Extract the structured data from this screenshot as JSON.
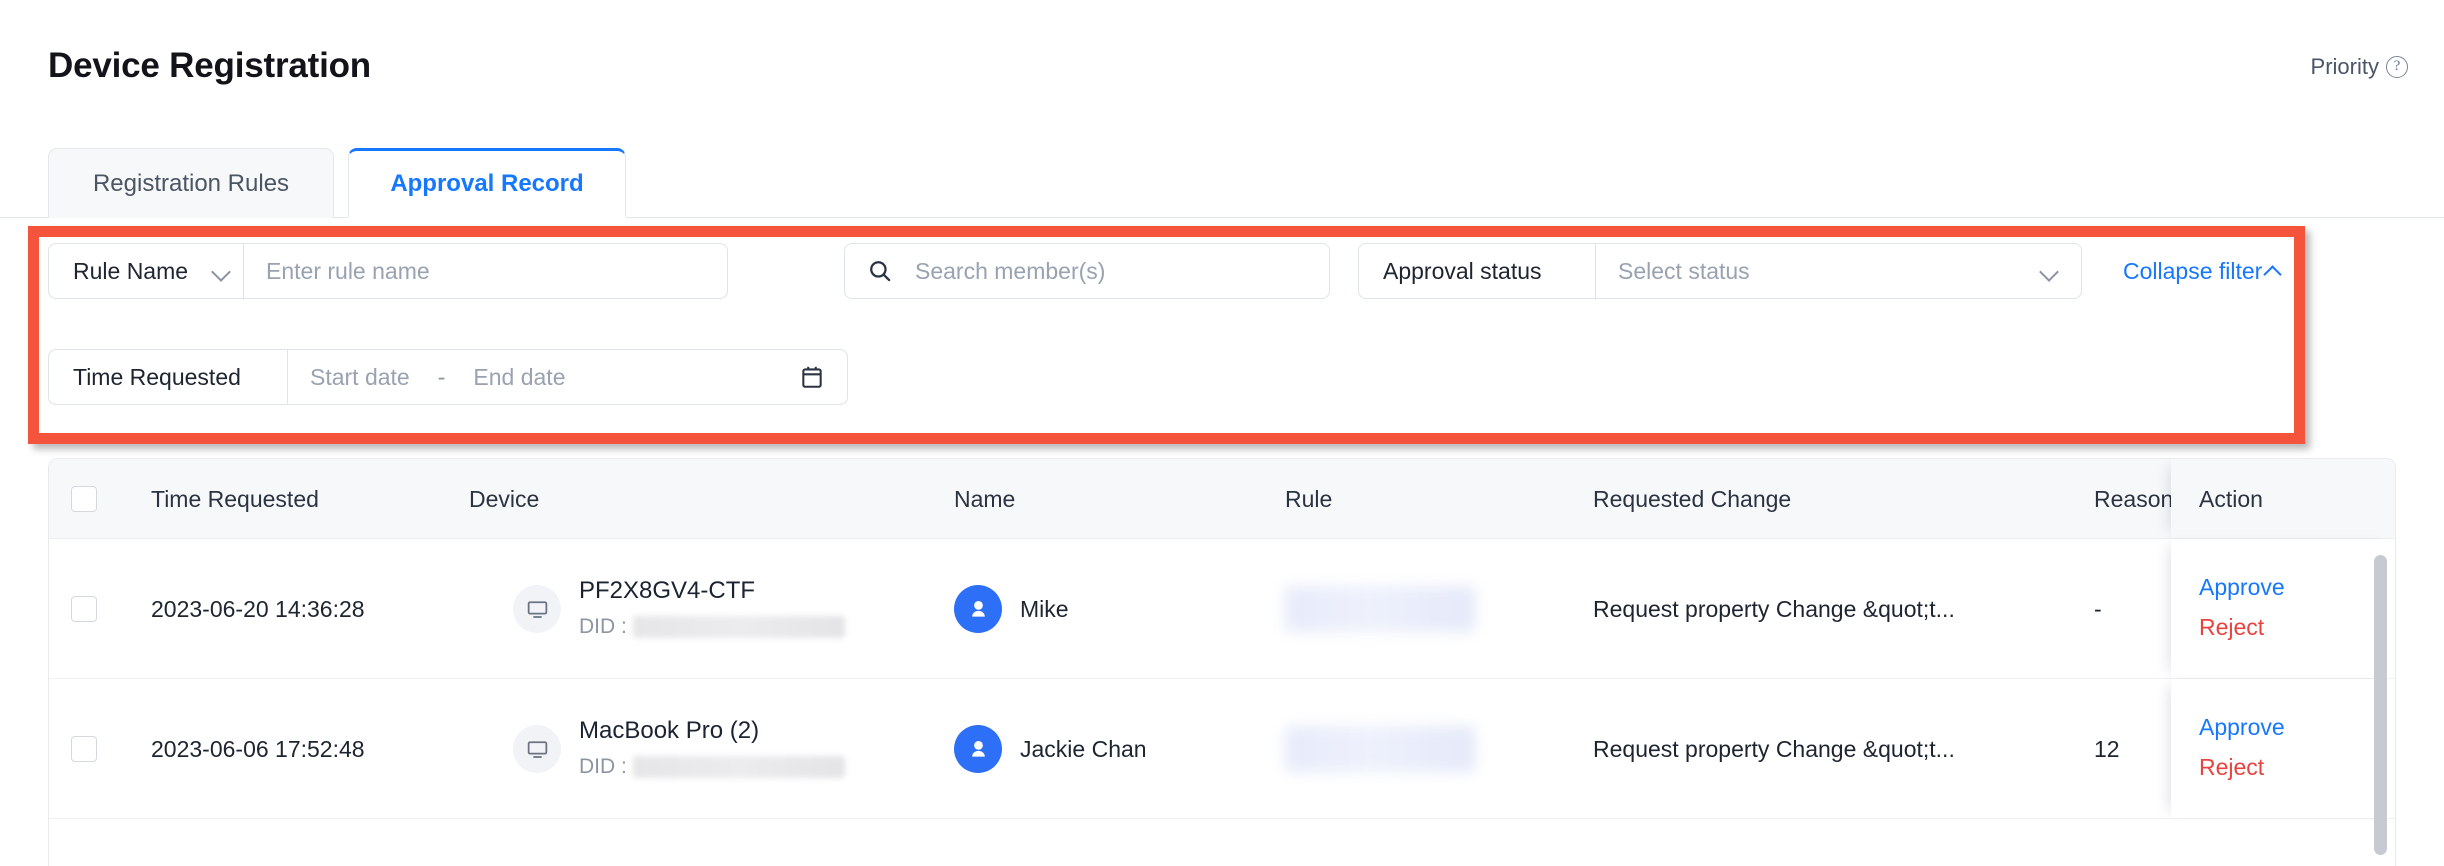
{
  "header": {
    "title": "Device Registration",
    "priority_label": "Priority",
    "help_icon": "question-circle-icon"
  },
  "tabs": [
    {
      "label": "Registration Rules",
      "active": false
    },
    {
      "label": "Approval Record",
      "active": true
    }
  ],
  "filters": {
    "rule_name_select": "Rule Name",
    "rule_name_placeholder": "Enter rule name",
    "rule_name_value": "",
    "member_search_placeholder": "Search member(s)",
    "member_search_value": "",
    "approval_status_label": "Approval status",
    "approval_status_placeholder": "Select status",
    "approval_status_value": "",
    "collapse_filter_label": "Collapse filter",
    "time_requested_label": "Time Requested",
    "start_date_placeholder": "Start date",
    "end_date_placeholder": "End date",
    "date_separator": "-",
    "calendar_icon": "calendar-icon",
    "search_icon": "search-icon",
    "highlight_color": "#f4543c"
  },
  "table": {
    "columns": [
      "Time Requested",
      "Device",
      "Name",
      "Rule",
      "Requested Change",
      "Reason",
      "Action"
    ],
    "rows": [
      {
        "time_requested": "2023-06-20 14:36:28",
        "device_name": "PF2X8GV4-CTF",
        "device_did_label": "DID :",
        "device_did_value": "",
        "name": "Mike",
        "rule": "",
        "requested_change": "Request property Change &quot;t...",
        "reason": "-",
        "actions": {
          "approve": "Approve",
          "reject": "Reject"
        }
      },
      {
        "time_requested": "2023-06-06 17:52:48",
        "device_name": "MacBook Pro (2)",
        "device_did_label": "DID :",
        "device_did_value": "",
        "name": "Jackie Chan",
        "rule": "",
        "requested_change": "Request property Change &quot;t...",
        "reason": "12",
        "actions": {
          "approve": "Approve",
          "reject": "Reject"
        }
      }
    ]
  },
  "colors": {
    "accent_blue": "#1677ff",
    "reject_red": "#e8433f",
    "highlight_red": "#f4543c",
    "avatar_blue": "#2d6ff7"
  }
}
